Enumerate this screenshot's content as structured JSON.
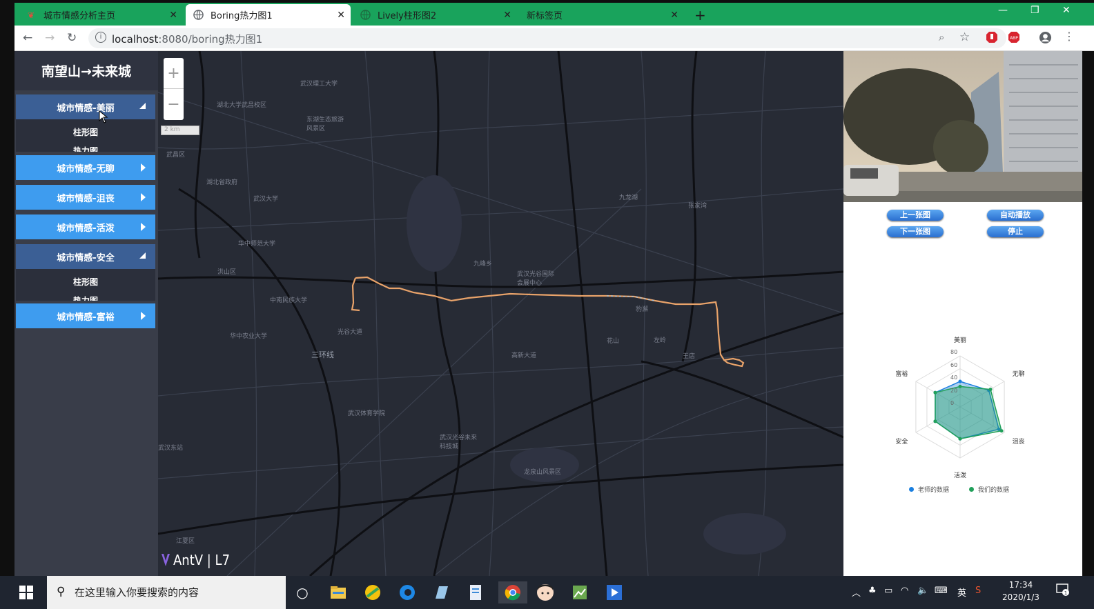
{
  "browser": {
    "tabs": [
      {
        "label": "城市情感分析主页",
        "icon": "app-favicon-icon",
        "active": false
      },
      {
        "label": "Boring热力图1",
        "icon": "globe-icon",
        "active": true
      },
      {
        "label": "Lively柱形图2",
        "icon": "globe-icon",
        "active": false
      },
      {
        "label": "新标签页",
        "icon": "",
        "active": false
      }
    ],
    "url_host": "localhost",
    "url_rest": ":8080/boring热力图1"
  },
  "sidebar": {
    "title": "南望山→未来城",
    "items": [
      {
        "label": "城市情感-美丽",
        "open": true,
        "subs": [
          "柱形图",
          "热力图"
        ]
      },
      {
        "label": "城市情感-无聊",
        "open": false
      },
      {
        "label": "城市情感-沮丧",
        "open": false
      },
      {
        "label": "城市情感-活泼",
        "open": false
      },
      {
        "label": "城市情感-安全",
        "open": true,
        "subs": [
          "柱形图",
          "热力图"
        ]
      },
      {
        "label": "城市情感-富裕",
        "open": false
      }
    ]
  },
  "map": {
    "scale_label": "2 km",
    "logo_text": "AntV | L7",
    "place_labels": [
      "武汉理工大学",
      "东湖生态旅游风景区",
      "湖北大学武昌校区",
      "武昌区",
      "湖北省政府",
      "武汉大学",
      "华中师范大学",
      "洪山区",
      "中南民族大学",
      "华中农业大学",
      "光谷大道",
      "武汉东站",
      "武汉光谷国际会展中心",
      "豹澥",
      "左岭",
      "王店",
      "花山",
      "武汉体育学院",
      "三环线",
      "江夏区",
      "龙泉山风景区",
      "九峰乡",
      "张家湾",
      "武汉光谷未来科技城",
      "九龙湖",
      "高新大道"
    ]
  },
  "controls": {
    "prev": "上一张图",
    "next": "下一张图",
    "auto": "自动播放",
    "stop": "停止"
  },
  "radar": {
    "axes": [
      "美丽",
      "无聊",
      "沮丧",
      "活泼",
      "安全",
      "富裕"
    ],
    "ticks": [
      "80",
      "60",
      "40",
      "20",
      "0"
    ],
    "series": [
      {
        "name": "老师的数据",
        "color": "#1a7fe0",
        "values": [
          40,
          52,
          70,
          50,
          45,
          45
        ]
      },
      {
        "name": "我们的数据",
        "color": "#21a05a",
        "values": [
          32,
          55,
          75,
          50,
          45,
          45
        ]
      }
    ],
    "max": 80
  },
  "taskbar": {
    "search_placeholder": "在这里输入你要搜索的内容",
    "ime": "英",
    "time": "17:34",
    "date": "2020/1/3",
    "notifications": "1"
  }
}
